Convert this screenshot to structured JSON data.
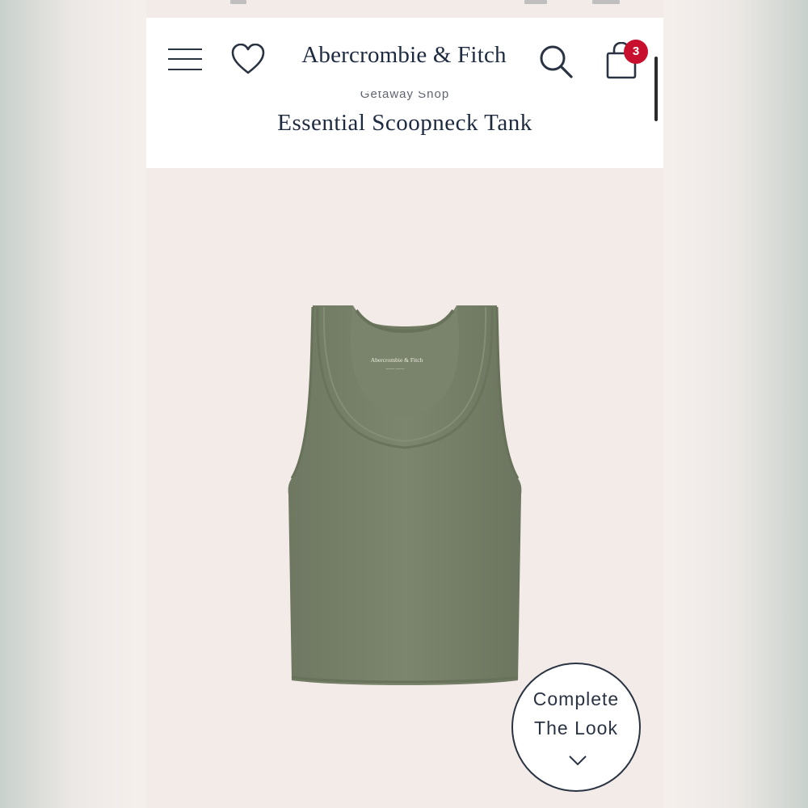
{
  "header": {
    "brand": "Abercrombie & Fitch",
    "cart_count": "3",
    "breadcrumb": "Getaway Shop",
    "product_title": "Essential Scoopneck Tank"
  },
  "product": {
    "image_desc_icon": "tank-top-image",
    "garment_color": "#7a836b",
    "label_text": "Abercrombie & Fitch"
  },
  "cta": {
    "line1": "Complete",
    "line2": "The Look"
  },
  "colors": {
    "accent": "#1d2a40",
    "badge": "#c8102e",
    "background": "#f3ebe8"
  }
}
